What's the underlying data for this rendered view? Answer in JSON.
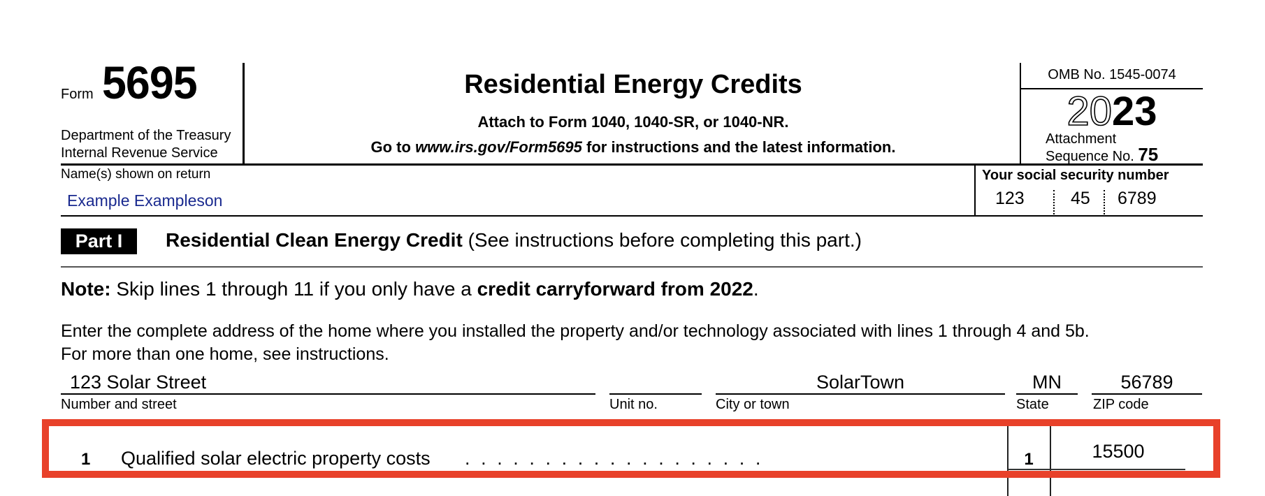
{
  "header": {
    "form_word": "Form",
    "form_number": "5695",
    "department": "Department of the Treasury",
    "agency": "Internal Revenue Service",
    "title": "Residential Energy Credits",
    "attach_line": "Attach to Form 1040, 1040-SR, or 1040-NR.",
    "goto_prefix": "Go to ",
    "goto_url": "www.irs.gov/Form5695",
    "goto_suffix": " for instructions and the latest information.",
    "omb": "OMB No. 1545-0074",
    "year_outline": "20",
    "year_solid": "23",
    "attachment_label": "Attachment",
    "sequence_label": "Sequence No.",
    "sequence_number": "75"
  },
  "taxpayer": {
    "name_label": "Name(s) shown on return",
    "name_value": "Example Exampleson",
    "ssn_label": "Your social security number",
    "ssn_parts": [
      "123",
      "45",
      "6789"
    ]
  },
  "part1": {
    "badge": "Part I",
    "title": "Residential Clean Energy Credit",
    "title_note": " (See instructions before completing this part.)",
    "note_label": "Note:",
    "note_text": " Skip lines 1 through 11 if you only have a ",
    "note_bold": "credit carryforward from 2022",
    "note_end": ".",
    "instructions_line1": "Enter the complete address of the home where you installed the property and/or technology associated with lines 1 through 4 and 5b.",
    "instructions_line2": "For more than one home, see instructions."
  },
  "address": {
    "street_value": "123 Solar Street",
    "street_label": "Number and street",
    "unit_value": "",
    "unit_label": "Unit no.",
    "city_value": "SolarTown",
    "city_label": "City or town",
    "state_value": "MN",
    "state_label": "State",
    "zip_value": "56789",
    "zip_label": "ZIP code"
  },
  "line1": {
    "number": "1",
    "description": "Qualified solar electric property costs",
    "dots": "...................",
    "box_number": "1",
    "amount": "15500"
  },
  "colors": {
    "highlight": "#e8412a",
    "name_text": "#1a2a8f"
  }
}
